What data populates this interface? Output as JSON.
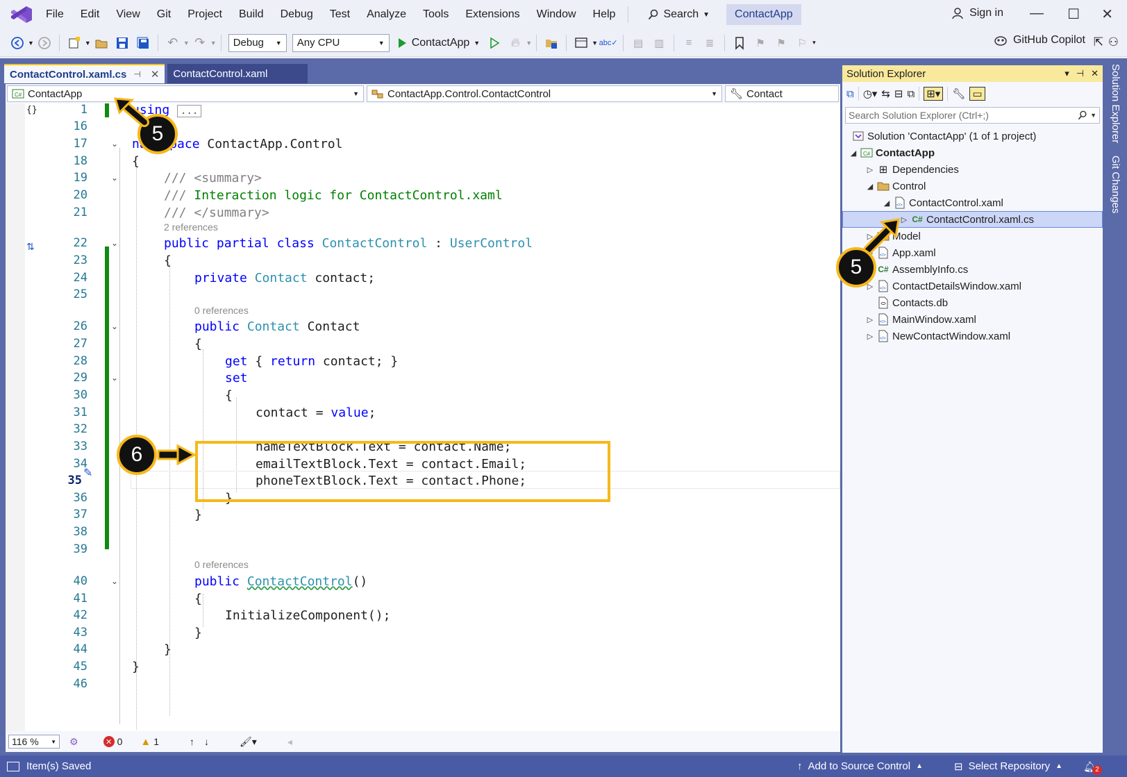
{
  "menubar": {
    "items": [
      "File",
      "Edit",
      "View",
      "Git",
      "Project",
      "Build",
      "Debug",
      "Test",
      "Analyze",
      "Tools",
      "Extensions",
      "Window",
      "Help"
    ],
    "search_label": "Search",
    "app_name": "ContactApp",
    "sign_in": "Sign in"
  },
  "toolbar": {
    "config": "Debug",
    "platform": "Any CPU",
    "run_target": "ContactApp",
    "copilot": "GitHub Copilot"
  },
  "tabs": {
    "active": "ContactControl.xaml.cs",
    "inactive": "ContactControl.xaml"
  },
  "navbar": {
    "project": "ContactApp",
    "type": "ContactApp.Control.ContactControl",
    "member": "Contact"
  },
  "editor": {
    "lines": [
      {
        "n": "1",
        "code": "using ..."
      },
      {
        "n": "16",
        "code": ""
      },
      {
        "n": "17",
        "code": "namespace ContactApp.Control"
      },
      {
        "n": "18",
        "code": "{"
      },
      {
        "n": "19",
        "code": "/// <summary>"
      },
      {
        "n": "20",
        "code": "/// Interaction logic for ContactControl.xaml"
      },
      {
        "n": "21",
        "code": "/// </summary>"
      },
      {
        "n": "22",
        "code": "public partial class ContactControl : UserControl"
      },
      {
        "n": "23",
        "code": "{"
      },
      {
        "n": "24",
        "code": "private Contact contact;"
      },
      {
        "n": "25",
        "code": ""
      },
      {
        "n": "26",
        "code": "public Contact Contact"
      },
      {
        "n": "27",
        "code": "{"
      },
      {
        "n": "28",
        "code": "get { return contact; }"
      },
      {
        "n": "29",
        "code": "set"
      },
      {
        "n": "30",
        "code": "{"
      },
      {
        "n": "31",
        "code": "contact = value;"
      },
      {
        "n": "32",
        "code": ""
      },
      {
        "n": "33",
        "code": "nameTextBlock.Text = contact.Name;"
      },
      {
        "n": "34",
        "code": "emailTextBlock.Text = contact.Email;"
      },
      {
        "n": "35",
        "code": "phoneTextBlock.Text = contact.Phone;"
      },
      {
        "n": "36",
        "code": "}"
      },
      {
        "n": "37",
        "code": "}"
      },
      {
        "n": "38",
        "code": ""
      },
      {
        "n": "39",
        "code": ""
      },
      {
        "n": "40",
        "code": "public ContactControl()"
      },
      {
        "n": "41",
        "code": "{"
      },
      {
        "n": "42",
        "code": "InitializeComponent();"
      },
      {
        "n": "43",
        "code": "}"
      },
      {
        "n": "44",
        "code": "}"
      },
      {
        "n": "45",
        "code": "}"
      },
      {
        "n": "46",
        "code": ""
      }
    ],
    "refs_2": "2 references",
    "refs_0a": "0 references",
    "refs_0b": "0 references"
  },
  "editor_status": {
    "zoom": "116 %",
    "errors": "0",
    "warnings": "1"
  },
  "solution_explorer": {
    "title": "Solution Explorer",
    "search_placeholder": "Search Solution Explorer (Ctrl+;)",
    "items": [
      {
        "label": "Solution 'ContactApp' (1 of 1 project)"
      },
      {
        "label": "ContactApp"
      },
      {
        "label": "Dependencies"
      },
      {
        "label": "Control"
      },
      {
        "label": "ContactControl.xaml"
      },
      {
        "label": "ContactControl.xaml.cs"
      },
      {
        "label": "Model"
      },
      {
        "label": "App.xaml"
      },
      {
        "label": "AssemblyInfo.cs"
      },
      {
        "label": "ContactDetailsWindow.xaml"
      },
      {
        "label": "Contacts.db"
      },
      {
        "label": "MainWindow.xaml"
      },
      {
        "label": "NewContactWindow.xaml"
      }
    ]
  },
  "side_tabs": {
    "solution_explorer": "Solution Explorer",
    "git_changes": "Git Changes"
  },
  "statusbar": {
    "message": "Item(s) Saved",
    "source_control": "Add to Source Control",
    "repository": "Select Repository",
    "notifications": "2"
  },
  "callouts": {
    "step_a": "5",
    "step_b": "5",
    "step_c": "6"
  },
  "colors": {
    "accent": "#f6b81a",
    "frame": "#5b6aa8",
    "status": "#4a5ba6"
  }
}
